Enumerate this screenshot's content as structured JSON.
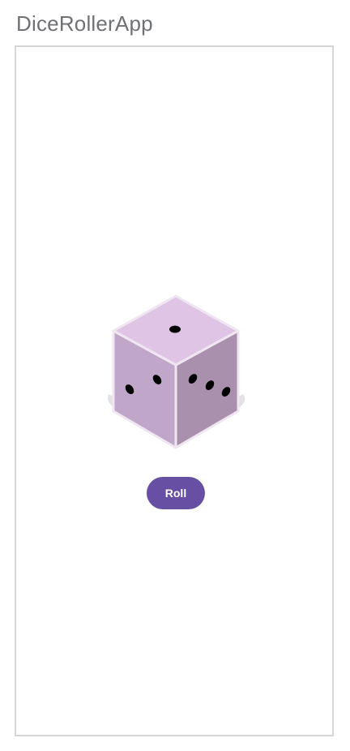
{
  "app": {
    "title": "DiceRollerApp"
  },
  "dice": {
    "top_face_value": 1,
    "left_face_value": 2,
    "right_face_value": 3,
    "colors": {
      "top": "#dfc4e6",
      "left": "#c0a6c8",
      "right": "#a990ad",
      "edge": "#f0e6f2",
      "pip": "#000000",
      "shadow": "#e3e3e3"
    }
  },
  "roll_button": {
    "label": "Roll",
    "color": "#6750a4"
  }
}
